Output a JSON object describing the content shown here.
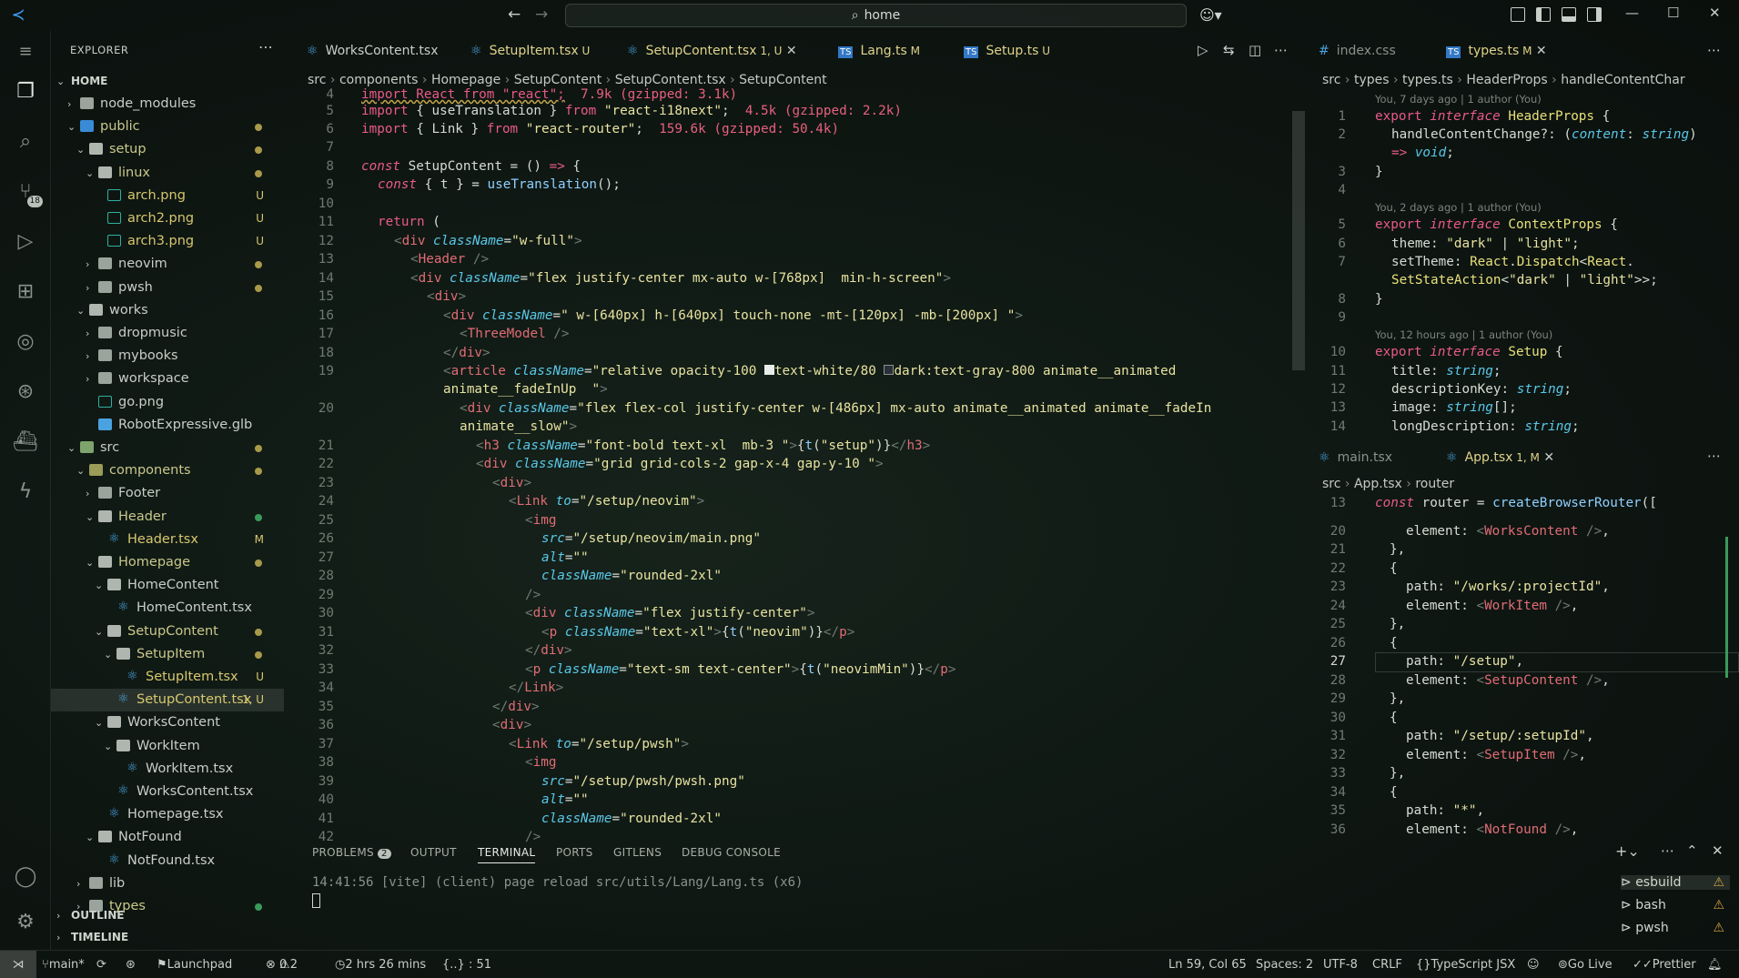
{
  "titlebar": {
    "search_text": "home"
  },
  "activity": {
    "scm_badge": "18"
  },
  "explorer": {
    "header": "EXPLORER",
    "root": "HOME",
    "outline": "OUTLINE",
    "timeline": "TIMELINE",
    "items": [
      {
        "name": "node_modules",
        "type": "folder",
        "depth": 1,
        "expanded": false
      },
      {
        "name": "public",
        "type": "folder",
        "depth": 1,
        "expanded": true
      },
      {
        "name": "setup",
        "type": "folder",
        "depth": 2,
        "expanded": true
      },
      {
        "name": "linux",
        "type": "folder",
        "depth": 3,
        "expanded": true
      },
      {
        "name": "arch.png",
        "type": "image",
        "depth": 4,
        "status": "U"
      },
      {
        "name": "arch2.png",
        "type": "image",
        "depth": 4,
        "status": "U"
      },
      {
        "name": "arch3.png",
        "type": "image",
        "depth": 4,
        "status": "U"
      },
      {
        "name": "neovim",
        "type": "folder",
        "depth": 3,
        "expanded": false
      },
      {
        "name": "pwsh",
        "type": "folder",
        "depth": 3,
        "expanded": false
      },
      {
        "name": "works",
        "type": "folder",
        "depth": 2,
        "expanded": true
      },
      {
        "name": "dropmusic",
        "type": "folder",
        "depth": 3,
        "expanded": false
      },
      {
        "name": "mybooks",
        "type": "folder",
        "depth": 3,
        "expanded": false
      },
      {
        "name": "workspace",
        "type": "folder",
        "depth": 3,
        "expanded": false
      },
      {
        "name": "go.png",
        "type": "image",
        "depth": 3
      },
      {
        "name": "RobotExpressive.glb",
        "type": "glb",
        "depth": 3
      },
      {
        "name": "src",
        "type": "folder",
        "depth": 1,
        "expanded": true
      },
      {
        "name": "components",
        "type": "folder",
        "depth": 2,
        "expanded": true
      },
      {
        "name": "Footer",
        "type": "folder",
        "depth": 3,
        "expanded": false
      },
      {
        "name": "Header",
        "type": "folder",
        "depth": 3,
        "expanded": true
      },
      {
        "name": "Header.tsx",
        "type": "react",
        "depth": 4,
        "status": "M"
      },
      {
        "name": "Homepage",
        "type": "folder",
        "depth": 3,
        "expanded": true
      },
      {
        "name": "HomeContent",
        "type": "folder",
        "depth": 4,
        "expanded": true
      },
      {
        "name": "HomeContent.tsx",
        "type": "react",
        "depth": 5
      },
      {
        "name": "SetupContent",
        "type": "folder",
        "depth": 4,
        "expanded": true
      },
      {
        "name": "SetupItem",
        "type": "folder",
        "depth": 5,
        "expanded": true
      },
      {
        "name": "SetupItem.tsx",
        "type": "react",
        "depth": 6,
        "status": "U"
      },
      {
        "name": "SetupContent.tsx",
        "type": "react",
        "depth": 5,
        "status": "1, U",
        "selected": true
      },
      {
        "name": "WorksContent",
        "type": "folder",
        "depth": 4,
        "expanded": true
      },
      {
        "name": "WorkItem",
        "type": "folder",
        "depth": 5,
        "expanded": true
      },
      {
        "name": "WorkItem.tsx",
        "type": "react",
        "depth": 6
      },
      {
        "name": "WorksContent.tsx",
        "type": "react",
        "depth": 5
      },
      {
        "name": "Homepage.tsx",
        "type": "react",
        "depth": 4
      },
      {
        "name": "NotFound",
        "type": "folder",
        "depth": 3,
        "expanded": true
      },
      {
        "name": "NotFound.tsx",
        "type": "react",
        "depth": 4
      },
      {
        "name": "lib",
        "type": "folder",
        "depth": 2,
        "expanded": false
      },
      {
        "name": "types",
        "type": "folder",
        "depth": 2,
        "expanded": false
      }
    ]
  },
  "editor1": {
    "tabs": [
      {
        "label": "WorksContent.tsx",
        "status": "",
        "color": "#c8cec8"
      },
      {
        "label": "SetupItem.tsx",
        "status": "U",
        "color": "#e0d38a"
      },
      {
        "label": "SetupContent.tsx",
        "status": "1, U",
        "color": "#e0d38a",
        "active": true
      },
      {
        "label": "Lang.ts",
        "status": "M",
        "color": "#e0d38a"
      },
      {
        "label": "Setup.ts",
        "status": "U",
        "color": "#e0d38a"
      }
    ],
    "breadcrumb": [
      "src",
      "components",
      "Homepage",
      "SetupContent",
      "SetupContent.tsx",
      "SetupContent"
    ]
  },
  "editor2": {
    "tabs": [
      {
        "label": "index.css",
        "status": "",
        "color": "#8a928c"
      },
      {
        "label": "types.ts",
        "status": "M",
        "color": "#e0d38a",
        "active": true
      }
    ],
    "breadcrumb": [
      "src",
      "types",
      "types.ts",
      "HeaderProps",
      "handleContentChar"
    ],
    "blame": [
      "You, 7 days ago | 1 author (You)",
      "You, 2 days ago | 1 author (You)",
      "You, 12 hours ago | 1 author (You)"
    ]
  },
  "editor3": {
    "tabs": [
      {
        "label": "main.tsx",
        "status": "",
        "color": "#8a928c"
      },
      {
        "label": "App.tsx",
        "status": "1, M",
        "color": "#e0d38a",
        "active": true
      }
    ],
    "breadcrumb": [
      "src",
      "App.tsx",
      "router"
    ],
    "sticky": "const router = createBrowserRouter(["
  },
  "panel": {
    "tabs": [
      "PROBLEMS",
      "OUTPUT",
      "TERMINAL",
      "PORTS",
      "GITLENS",
      "DEBUG CONSOLE"
    ],
    "problems_count": "2",
    "terminal_line": "14:41:56 [vite] (client) page reload src/utils/Lang/Lang.ts (x6)",
    "terminals": [
      "esbuild",
      "bash",
      "pwsh"
    ]
  },
  "status": {
    "branch": "main*",
    "launchpad": "Launchpad",
    "errors": "0",
    "warnings": "2",
    "time": "2 hrs 26 mins",
    "selection": "{..} : 51",
    "position": "Ln 59, Col 65",
    "spaces": "Spaces: 2",
    "encoding": "UTF-8",
    "eol": "CRLF",
    "language": "TypeScript JSX",
    "golive": "Go Live",
    "prettier": "Prettier"
  }
}
